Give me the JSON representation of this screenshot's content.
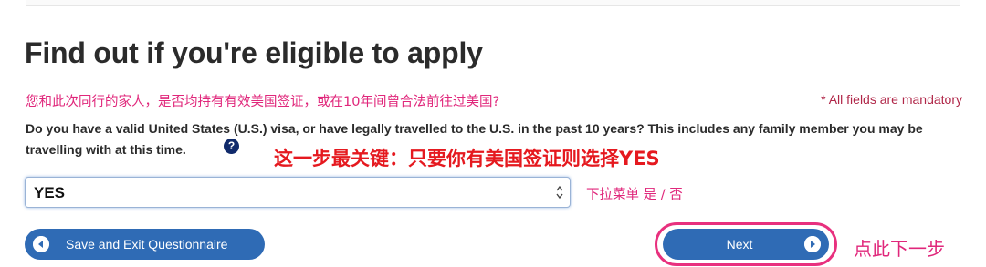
{
  "page": {
    "title": "Find out if you're eligible to apply",
    "mandatory_note": "* All fields are mandatory"
  },
  "annotations": {
    "question_translation": "您和此次同行的家人，是否均持有有效美国签证，或在10年间曾合法前往过美国?",
    "key_step": "这一步最关键：只要你有美国签证则选择YES",
    "dropdown_hint": "下拉菜单 是 / 否",
    "next_hint": "点此下一步"
  },
  "question": {
    "text": "Do you have a valid United States (U.S.) visa, or have legally travelled to the U.S. in the past 10 years?  This includes any family member you may be travelling with at this time.",
    "help_icon": "?"
  },
  "visa_select": {
    "selected": "YES"
  },
  "buttons": {
    "save_exit": "Save and Exit Questionnaire",
    "next": "Next"
  },
  "colors": {
    "button_blue": "#2f6bb5",
    "title_rule": "#b9415a",
    "annotation_pink": "#e0277b",
    "annotation_red": "#e5191f",
    "highlight_ring": "#e8307e"
  },
  "icons": {
    "save_button_icon": "arrow-left-circle-icon",
    "next_button_icon": "arrow-right-circle-icon",
    "help_icon": "question-circle-icon",
    "select_icon": "up-down-chevrons-icon"
  }
}
